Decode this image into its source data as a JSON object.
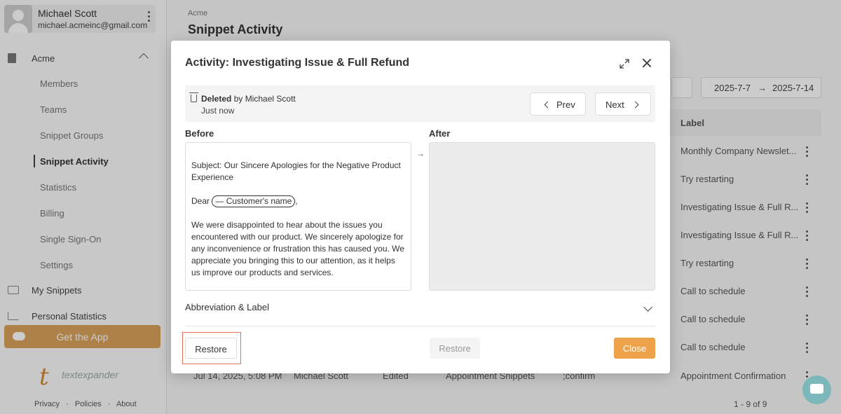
{
  "user": {
    "name": "Michael Scott",
    "email": "michael.acmeinc@gmail.com"
  },
  "sidebar": {
    "org": "Acme",
    "sub_items": [
      "Members",
      "Teams",
      "Snippet Groups",
      "Snippet Activity",
      "Statistics",
      "Billing",
      "Single Sign-On",
      "Settings"
    ],
    "my_snippets": "My Snippets",
    "personal_statistics": "Personal Statistics",
    "get_app": "Get the App",
    "logo_text": "textexpander",
    "footer": [
      "Privacy",
      "·",
      "Policies",
      "·",
      "About"
    ]
  },
  "page": {
    "breadcrumb": "Acme",
    "title": "Snippet Activity",
    "date_start": "2025-7-7",
    "date_arrow": "→",
    "date_end": "2025-7-14",
    "label_header": "Label",
    "labels": [
      "Monthly Company Newslet...",
      "Try restarting",
      "Investigating Issue & Full R...",
      "Investigating Issue & Full R...",
      "Try restarting",
      "Call to schedule",
      "Call to schedule",
      "Call to schedule",
      "Appointment Confirmation"
    ],
    "bottom_row": {
      "date": "Jul 14, 2025, 5:08 PM",
      "user": "Michael Scott",
      "action": "Edited",
      "group": "Appointment Snippets",
      "abbreviation": ";confirm"
    },
    "pagination": "1 - 9 of 9"
  },
  "modal": {
    "title": "Activity: Investigating Issue & Full Refund",
    "action": "Deleted",
    "by": "by Michael Scott",
    "time": "Just now",
    "prev": "Prev",
    "next": "Next",
    "before_label": "Before",
    "after_label": "After",
    "arrow": "→",
    "before_subject": "Subject: Our Sincere Apologies for the Negative Product Experience",
    "before_dear": "Dear",
    "before_token": "— Customer's name",
    "before_comma": ",",
    "before_body": "We were disappointed to hear about the issues you encountered with our product. We sincerely apologize for any inconvenience or frustration this has caused you. We appreciate you bringing this to our attention, as it helps us improve our products and services.",
    "abbrev_label": "Abbreviation & Label",
    "restore": "Restore",
    "restore_disabled": "Restore",
    "close": "Close"
  }
}
